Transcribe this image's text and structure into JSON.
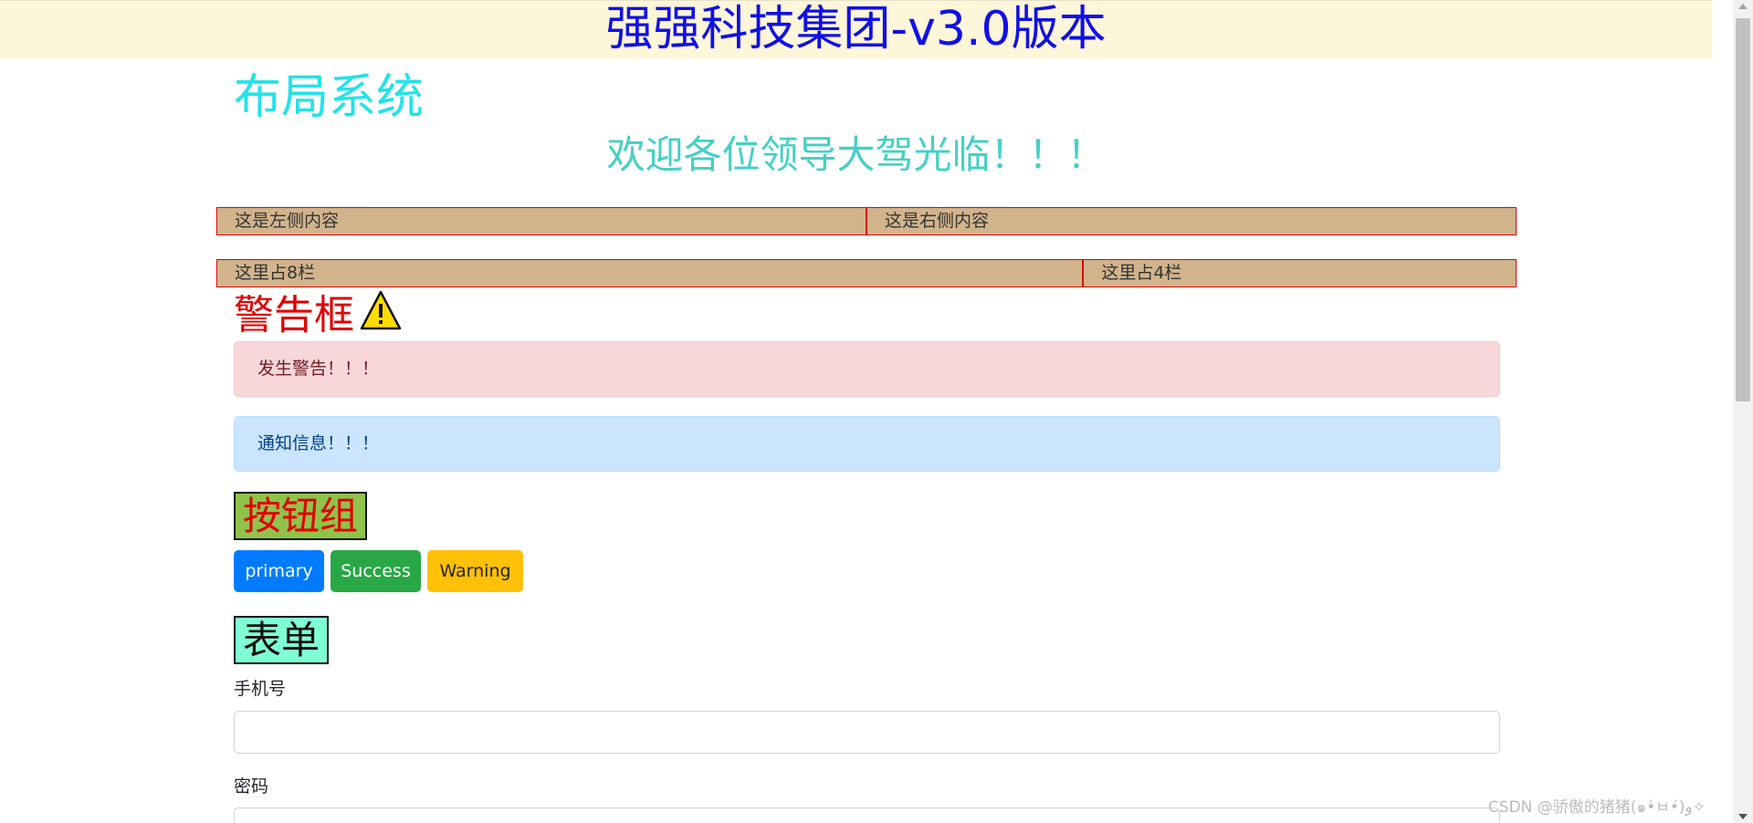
{
  "header": {
    "title": "强强科技集团-v3.0版本",
    "bg_color": "#fef6d8",
    "title_color": "#1010e8"
  },
  "page": {
    "heading": "布局系统",
    "welcome": "欢迎各位领导大驾光临！！！"
  },
  "grid": {
    "row1": [
      "这是左侧内容",
      "这是右侧内容"
    ],
    "row2": [
      "这里占8栏",
      "这里占4栏"
    ],
    "cell_bg": "#d2b48c",
    "cell_border": "#e00000"
  },
  "alerts_section": {
    "title": "警告框",
    "icon": "warning-icon",
    "items": [
      "发生警告！！！",
      "通知信息！！！"
    ]
  },
  "buttons_section": {
    "title": "按钮组",
    "buttons": [
      "primary",
      "Success",
      "Warning"
    ]
  },
  "form_section": {
    "title": "表单",
    "phone_label": "手机号",
    "phone_value": "",
    "password_label": "密码",
    "password_value": ""
  },
  "watermark": "CSDN @骄傲的猪猪(๑•̀ㅂ•́)و✧"
}
